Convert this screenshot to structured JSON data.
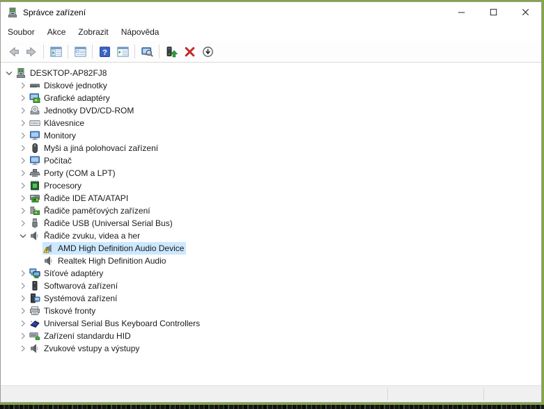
{
  "window": {
    "title": "Správce zařízení",
    "controls": [
      "minimize",
      "maximize",
      "close"
    ]
  },
  "menu": {
    "items": [
      {
        "label": "Soubor"
      },
      {
        "label": "Akce"
      },
      {
        "label": "Zobrazit"
      },
      {
        "label": "Nápověda"
      }
    ]
  },
  "toolbar": {
    "groups": [
      {
        "buttons": [
          {
            "icon": "back-icon",
            "disabled": true
          },
          {
            "icon": "forward-icon",
            "disabled": true
          }
        ]
      },
      {
        "buttons": [
          {
            "icon": "console-tree-icon"
          }
        ]
      },
      {
        "buttons": [
          {
            "icon": "properties-icon"
          }
        ]
      },
      {
        "buttons": [
          {
            "icon": "help-icon"
          },
          {
            "icon": "list-view-icon"
          }
        ]
      },
      {
        "buttons": [
          {
            "icon": "scan-hardware-icon"
          }
        ]
      },
      {
        "buttons": [
          {
            "icon": "update-driver-icon"
          },
          {
            "icon": "uninstall-icon"
          },
          {
            "icon": "disable-device-icon"
          }
        ]
      }
    ]
  },
  "tree": {
    "items": [
      {
        "label": "DESKTOP-AP82FJ8",
        "icon": "computer-icon",
        "level": 0,
        "expanded": true
      },
      {
        "label": "Diskové jednotky",
        "icon": "disk-drive-icon",
        "level": 1,
        "expanded": false
      },
      {
        "label": "Grafické adaptéry",
        "icon": "display-adapter-icon",
        "level": 1,
        "expanded": false
      },
      {
        "label": "Jednotky DVD/CD-ROM",
        "icon": "cd-drive-icon",
        "level": 1,
        "expanded": false
      },
      {
        "label": "Klávesnice",
        "icon": "keyboard-icon",
        "level": 1,
        "expanded": false
      },
      {
        "label": "Monitory",
        "icon": "monitor-icon",
        "level": 1,
        "expanded": false
      },
      {
        "label": "Myši a jiná polohovací zařízení",
        "icon": "mouse-icon",
        "level": 1,
        "expanded": false
      },
      {
        "label": "Počítač",
        "icon": "computer-monitor-icon",
        "level": 1,
        "expanded": false
      },
      {
        "label": "Porty (COM a LPT)",
        "icon": "port-icon",
        "level": 1,
        "expanded": false
      },
      {
        "label": "Procesory",
        "icon": "processor-icon",
        "level": 1,
        "expanded": false
      },
      {
        "label": "Řadiče IDE ATA/ATAPI",
        "icon": "ide-controller-icon",
        "level": 1,
        "expanded": false
      },
      {
        "label": "Řadiče paměťových zařízení",
        "icon": "storage-controller-icon",
        "level": 1,
        "expanded": false
      },
      {
        "label": "Řadiče USB (Universal Serial Bus)",
        "icon": "usb-controller-icon",
        "level": 1,
        "expanded": false
      },
      {
        "label": "Řadiče zvuku, videa a her",
        "icon": "audio-controller-icon",
        "level": 1,
        "expanded": true
      },
      {
        "label": "AMD High Definition Audio Device",
        "icon": "audio-warning-icon",
        "level": 2,
        "expanded": null,
        "selected": true,
        "warning": true
      },
      {
        "label": "Realtek High Definition Audio",
        "icon": "audio-device-icon",
        "level": 2,
        "expanded": null
      },
      {
        "label": "Síťové adaptéry",
        "icon": "network-adapter-icon",
        "level": 1,
        "expanded": false
      },
      {
        "label": "Softwarová zařízení",
        "icon": "software-device-icon",
        "level": 1,
        "expanded": false
      },
      {
        "label": "Systémová zařízení",
        "icon": "system-device-icon",
        "level": 1,
        "expanded": false
      },
      {
        "label": "Tiskové fronty",
        "icon": "printer-icon",
        "level": 1,
        "expanded": false
      },
      {
        "label": "Universal Serial Bus Keyboard Controllers",
        "icon": "usb-keyboard-icon",
        "level": 1,
        "expanded": false
      },
      {
        "label": "Zařízení standardu HID",
        "icon": "hid-device-icon",
        "level": 1,
        "expanded": false
      },
      {
        "label": "Zvukové vstupy a výstupy",
        "icon": "audio-io-icon",
        "level": 1,
        "expanded": false
      }
    ]
  },
  "status_bar": {
    "text": ""
  },
  "colors": {
    "selection_highlight": "#cce8ff",
    "desktop_green": "#84a647",
    "warning_yellow": "#fdd835",
    "uninstall_red": "#c62828",
    "help_blue": "#3a66c6"
  }
}
